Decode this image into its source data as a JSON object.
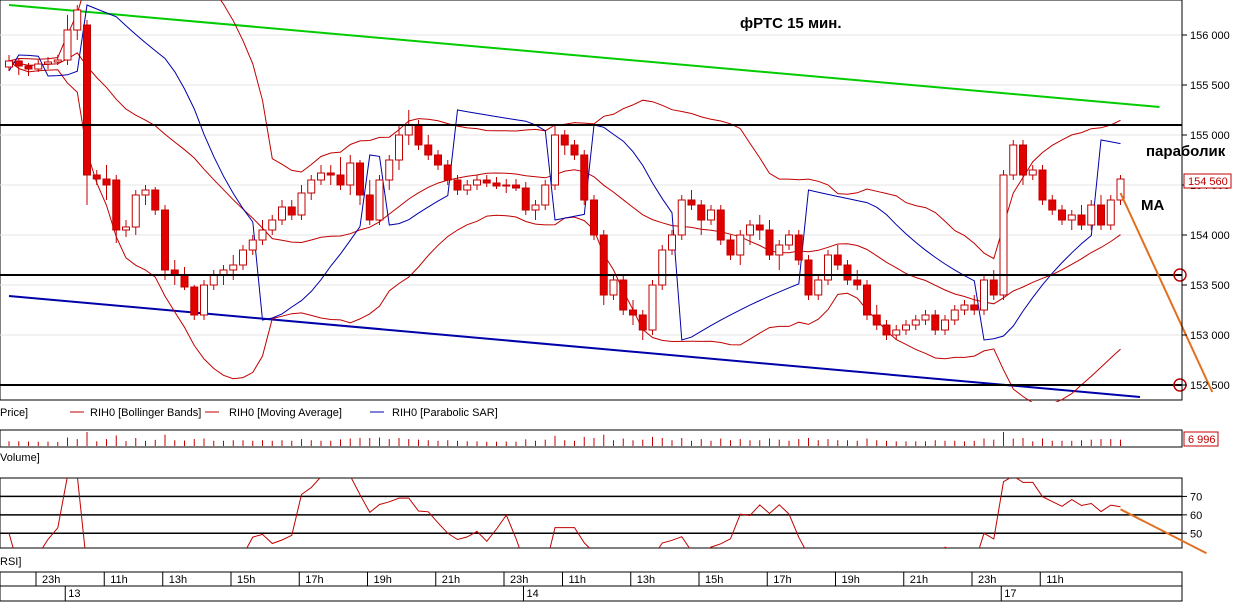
{
  "chart_data": {
    "type": "candlestick",
    "title": "фРТС   15 мин.",
    "annotations": {
      "parabolic": "параболик",
      "ma": "MA"
    },
    "price_axis": {
      "ticks": [
        152500,
        153000,
        153500,
        154000,
        154500,
        155000,
        155500,
        156000
      ],
      "tick_labels": [
        "152 500",
        "153 000",
        "153 500",
        "154 000",
        "154 500",
        "155 000",
        "155 500",
        "156 000"
      ],
      "ylim": [
        152350,
        156350
      ],
      "last_price_label": "154 560",
      "horizontal_levels": [
        155100,
        153600,
        152500
      ]
    },
    "legend": {
      "price": "Price]",
      "bollinger": "RIH0 [Bollinger Bands]",
      "ma": "RIH0 [Moving Average]",
      "psar": "RIH0 [Parabolic SAR]"
    },
    "trendlines": [
      {
        "name": "resistance",
        "color": "#00cc00",
        "points": [
          [
            0,
            156300
          ],
          [
            118,
            155280
          ]
        ]
      },
      {
        "name": "support",
        "color": "#0000aa",
        "points": [
          [
            0,
            153390
          ],
          [
            116,
            152380
          ]
        ]
      }
    ],
    "projection": {
      "color": "#e07020",
      "points": [
        [
          114,
          154420
        ],
        [
          123,
          152430
        ]
      ]
    },
    "candles": [
      [
        0,
        155680,
        155800,
        155640,
        155740
      ],
      [
        1,
        155740,
        155760,
        155600,
        155690
      ],
      [
        2,
        155690,
        155720,
        155590,
        155660
      ],
      [
        3,
        155660,
        155750,
        155630,
        155710
      ],
      [
        4,
        155710,
        155780,
        155660,
        155730
      ],
      [
        5,
        155730,
        155800,
        155700,
        155750
      ],
      [
        6,
        155750,
        156200,
        155700,
        156050
      ],
      [
        7,
        156050,
        156300,
        155950,
        156250
      ],
      [
        8,
        156100,
        156150,
        154300,
        154600
      ],
      [
        9,
        154600,
        154650,
        154500,
        154560
      ],
      [
        10,
        154560,
        154700,
        154350,
        154500
      ],
      [
        11,
        154550,
        154600,
        153920,
        154050
      ],
      [
        12,
        154050,
        154150,
        153980,
        154080
      ],
      [
        13,
        154080,
        154450,
        154000,
        154400
      ],
      [
        14,
        154400,
        154500,
        154300,
        154450
      ],
      [
        15,
        154450,
        154480,
        154200,
        154250
      ],
      [
        16,
        154250,
        154300,
        153550,
        153650
      ],
      [
        17,
        153650,
        153750,
        153500,
        153600
      ],
      [
        18,
        153600,
        153680,
        153450,
        153480
      ],
      [
        19,
        153480,
        153500,
        153150,
        153200
      ],
      [
        20,
        153200,
        153550,
        153150,
        153500
      ],
      [
        21,
        153500,
        153650,
        153450,
        153600
      ],
      [
        22,
        153600,
        153700,
        153500,
        153650
      ],
      [
        23,
        153650,
        153800,
        153550,
        153700
      ],
      [
        24,
        153700,
        153900,
        153650,
        153850
      ],
      [
        25,
        153850,
        154000,
        153800,
        153950
      ],
      [
        26,
        153950,
        154150,
        153900,
        154050
      ],
      [
        27,
        154050,
        154200,
        154000,
        154150
      ],
      [
        28,
        154150,
        154350,
        154100,
        154280
      ],
      [
        29,
        154280,
        154350,
        154150,
        154200
      ],
      [
        30,
        154200,
        154500,
        154150,
        154420
      ],
      [
        31,
        154420,
        154600,
        154350,
        154550
      ],
      [
        32,
        154550,
        154700,
        154500,
        154620
      ],
      [
        33,
        154620,
        154700,
        154500,
        154600
      ],
      [
        34,
        154600,
        154780,
        154450,
        154500
      ],
      [
        35,
        154500,
        154800,
        154400,
        154720
      ],
      [
        36,
        154720,
        154750,
        154300,
        154400
      ],
      [
        37,
        154400,
        154550,
        154100,
        154150
      ],
      [
        38,
        154150,
        154600,
        154100,
        154550
      ],
      [
        39,
        154550,
        154800,
        154450,
        154750
      ],
      [
        40,
        154750,
        155100,
        154650,
        155000
      ],
      [
        41,
        155000,
        155250,
        154900,
        155100
      ],
      [
        42,
        155100,
        155150,
        154850,
        154900
      ],
      [
        43,
        154900,
        155000,
        154750,
        154800
      ],
      [
        44,
        154800,
        154850,
        154650,
        154700
      ],
      [
        45,
        154700,
        154750,
        154500,
        154550
      ],
      [
        46,
        154550,
        154600,
        154400,
        154450
      ],
      [
        47,
        154450,
        154550,
        154400,
        154500
      ],
      [
        48,
        154500,
        154600,
        154450,
        154550
      ],
      [
        49,
        154550,
        154600,
        154480,
        154520
      ],
      [
        50,
        154520,
        154580,
        154460,
        154490
      ],
      [
        51,
        154490,
        154560,
        154420,
        154500
      ],
      [
        52,
        154500,
        154560,
        154440,
        154470
      ],
      [
        53,
        154470,
        154530,
        154200,
        154250
      ],
      [
        54,
        154250,
        154350,
        154150,
        154300
      ],
      [
        55,
        154300,
        154550,
        154250,
        154500
      ],
      [
        56,
        154500,
        155100,
        154450,
        155000
      ],
      [
        57,
        155000,
        155050,
        154800,
        154900
      ],
      [
        58,
        154900,
        154950,
        154750,
        154800
      ],
      [
        59,
        154800,
        154850,
        154300,
        154350
      ],
      [
        60,
        154350,
        154400,
        153950,
        154000
      ],
      [
        61,
        154000,
        154050,
        153300,
        153400
      ],
      [
        62,
        153400,
        153600,
        153350,
        153550
      ],
      [
        63,
        153550,
        153600,
        153200,
        153250
      ],
      [
        64,
        153250,
        153350,
        153100,
        153200
      ],
      [
        65,
        153200,
        153250,
        152950,
        153050
      ],
      [
        66,
        153050,
        153550,
        153000,
        153500
      ],
      [
        67,
        153500,
        153900,
        153450,
        153850
      ],
      [
        68,
        153850,
        154050,
        153800,
        154000
      ],
      [
        69,
        154000,
        154400,
        153950,
        154350
      ],
      [
        70,
        154350,
        154450,
        154250,
        154300
      ],
      [
        71,
        154300,
        154350,
        154000,
        154150
      ],
      [
        72,
        154150,
        154300,
        154100,
        154250
      ],
      [
        73,
        154250,
        154300,
        153900,
        153950
      ],
      [
        74,
        153950,
        154000,
        153750,
        153800
      ],
      [
        75,
        153800,
        154050,
        153700,
        154000
      ],
      [
        76,
        154000,
        154150,
        153900,
        154100
      ],
      [
        77,
        154100,
        154200,
        153950,
        154050
      ],
      [
        78,
        154050,
        154150,
        153750,
        153800
      ],
      [
        79,
        153800,
        153950,
        153650,
        153900
      ],
      [
        80,
        153900,
        154050,
        153850,
        154000
      ],
      [
        81,
        154000,
        154050,
        153700,
        153750
      ],
      [
        82,
        153750,
        153800,
        153350,
        153400
      ],
      [
        83,
        153400,
        153600,
        153350,
        153550
      ],
      [
        84,
        153550,
        153850,
        153500,
        153800
      ],
      [
        85,
        153800,
        153900,
        153650,
        153700
      ],
      [
        86,
        153700,
        153750,
        153500,
        153550
      ],
      [
        87,
        153550,
        153650,
        153450,
        153500
      ],
      [
        88,
        153500,
        153550,
        153150,
        153200
      ],
      [
        89,
        153200,
        153300,
        153050,
        153100
      ],
      [
        90,
        153100,
        153150,
        152950,
        153000
      ],
      [
        91,
        153000,
        153100,
        152950,
        153050
      ],
      [
        92,
        153050,
        153150,
        153000,
        153100
      ],
      [
        93,
        153100,
        153200,
        153050,
        153150
      ],
      [
        94,
        153150,
        153250,
        153100,
        153200
      ],
      [
        95,
        153200,
        153250,
        153000,
        153050
      ],
      [
        96,
        153050,
        153200,
        153000,
        153150
      ],
      [
        97,
        153150,
        153300,
        153100,
        153250
      ],
      [
        98,
        153250,
        153350,
        153200,
        153300
      ],
      [
        99,
        153300,
        153400,
        153200,
        153250
      ],
      [
        100,
        153250,
        153600,
        153200,
        153550
      ],
      [
        101,
        153550,
        153650,
        153350,
        153400
      ],
      [
        102,
        153400,
        154650,
        153350,
        154600
      ],
      [
        103,
        154600,
        154950,
        154550,
        154900
      ],
      [
        104,
        154900,
        154950,
        154500,
        154600
      ],
      [
        105,
        154600,
        154700,
        154550,
        154650
      ],
      [
        106,
        154650,
        154700,
        154300,
        154350
      ],
      [
        107,
        154350,
        154400,
        154200,
        154250
      ],
      [
        108,
        154250,
        154300,
        154100,
        154150
      ],
      [
        109,
        154150,
        154250,
        154050,
        154200
      ],
      [
        110,
        154200,
        154300,
        154050,
        154100
      ],
      [
        111,
        154100,
        154350,
        154050,
        154300
      ],
      [
        112,
        154300,
        154400,
        154050,
        154100
      ],
      [
        113,
        154100,
        154400,
        154050,
        154350
      ],
      [
        114,
        154350,
        154600,
        154300,
        154560
      ]
    ],
    "volume": {
      "label": "Volume]",
      "last_value_label": "6 996",
      "max": 7000
    },
    "rsi": {
      "label": "RSI]",
      "ylim": [
        42,
        80
      ],
      "ticks": [
        50,
        60,
        70
      ],
      "levels": [
        70,
        60,
        50
      ],
      "projection": {
        "points": [
          [
            114,
            63
          ],
          [
            122,
            50
          ]
        ]
      }
    },
    "time_axis": {
      "hour_labels": [
        "23h",
        "11h",
        "13h",
        "15h",
        "17h",
        "19h",
        "21h",
        "23h",
        "11h",
        "13h",
        "15h",
        "17h",
        "19h",
        "21h",
        "23h",
        "11h"
      ],
      "hour_label_indices": [
        4,
        11,
        17,
        24,
        31,
        38,
        45,
        52,
        58,
        65,
        72,
        79,
        86,
        93,
        100,
        107
      ],
      "date_labels": [
        "13",
        "14",
        "17"
      ],
      "date_label_indices": [
        7,
        54,
        103
      ]
    }
  }
}
